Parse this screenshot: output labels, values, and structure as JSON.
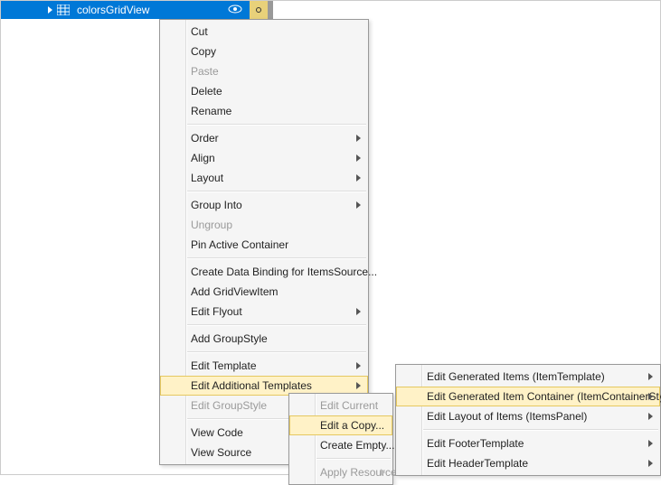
{
  "outline": {
    "item_label": "colorsGridView"
  },
  "menu1": {
    "cut": "Cut",
    "copy": "Copy",
    "paste": "Paste",
    "delete": "Delete",
    "rename": "Rename",
    "order": "Order",
    "align": "Align",
    "layout": "Layout",
    "group_into": "Group Into",
    "ungroup": "Ungroup",
    "pin_active": "Pin Active Container",
    "create_binding": "Create Data Binding for ItemsSource...",
    "add_gvi": "Add GridViewItem",
    "edit_flyout": "Edit Flyout",
    "add_groupstyle": "Add GroupStyle",
    "edit_template": "Edit Template",
    "edit_additional": "Edit Additional Templates",
    "edit_groupstyle": "Edit GroupStyle",
    "view_code": "View Code",
    "view_source": "View Source"
  },
  "menu2": {
    "edit_current": "Edit Current",
    "edit_copy": "Edit a Copy...",
    "create_empty": "Create Empty...",
    "apply_resource": "Apply Resource"
  },
  "menu3": {
    "gen_items": "Edit Generated Items (ItemTemplate)",
    "gen_container": "Edit Generated Item Container (ItemContainerStyle)",
    "layout_items": "Edit Layout of Items (ItemsPanel)",
    "footer": "Edit FooterTemplate",
    "header": "Edit HeaderTemplate"
  }
}
